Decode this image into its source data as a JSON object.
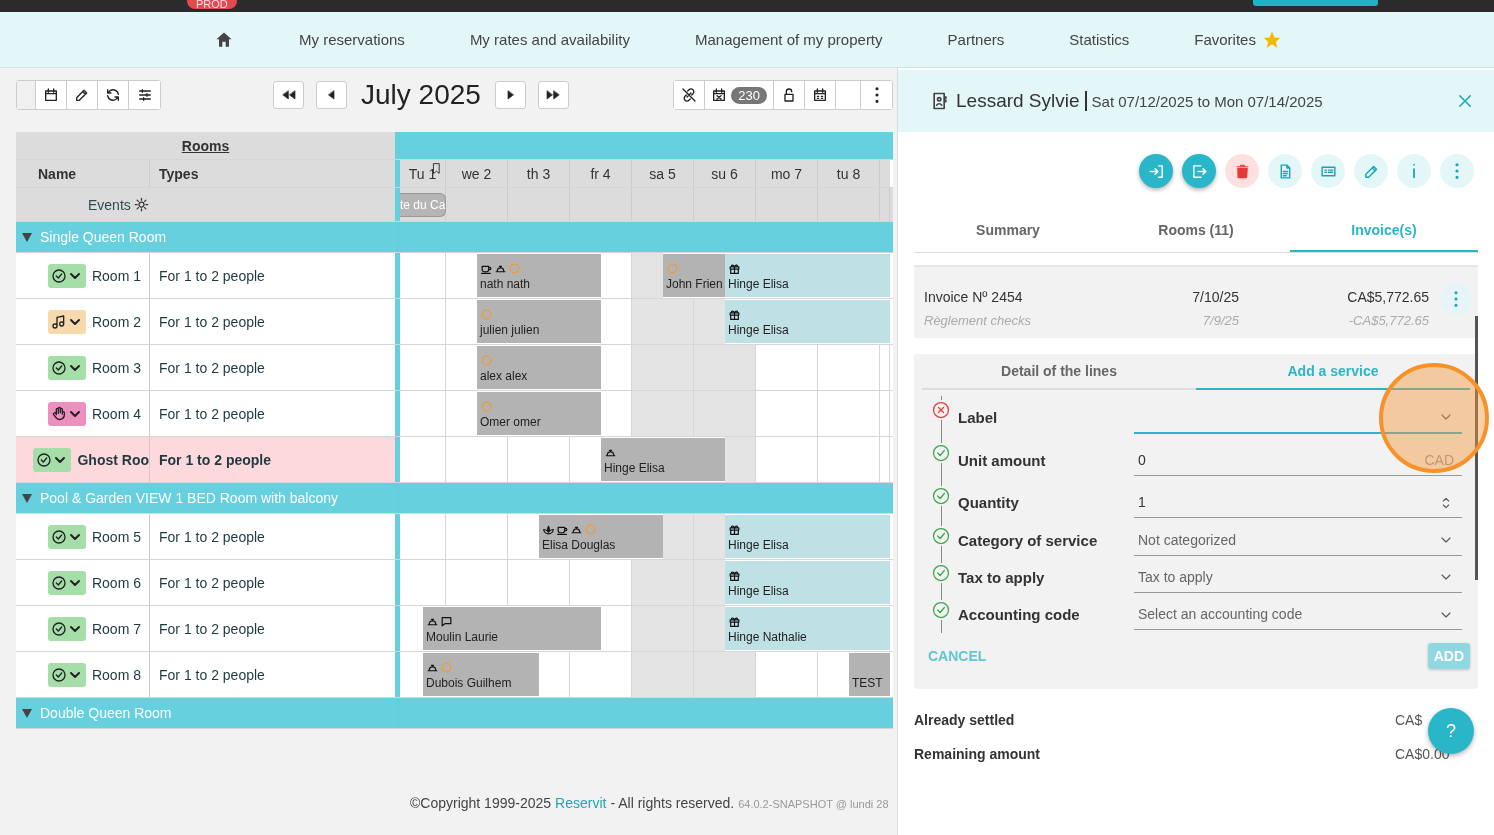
{
  "top_bar": {
    "env_badge": "PROD"
  },
  "nav": {
    "items": [
      {
        "label": "My reservations",
        "starred": false
      },
      {
        "label": "My rates and availability",
        "starred": false
      },
      {
        "label": "Management of my property",
        "starred": false
      },
      {
        "label": "Partners",
        "starred": false
      },
      {
        "label": "Statistics",
        "starred": false
      },
      {
        "label": "Favorites",
        "starred": true
      }
    ]
  },
  "planning": {
    "month": "July 2025",
    "closed_count": "230",
    "rooms_heading": "Rooms",
    "columns": [
      "Name",
      "Types"
    ],
    "events_label": "Events",
    "days": [
      {
        "label": "Tu 1",
        "weekend": false,
        "flagged": true,
        "event": "te du Ca"
      },
      {
        "label": "we 2",
        "weekend": false,
        "flagged": false
      },
      {
        "label": "th 3",
        "weekend": false,
        "flagged": false
      },
      {
        "label": "fr 4",
        "weekend": false,
        "flagged": false
      },
      {
        "label": "sa 5",
        "weekend": true,
        "flagged": false
      },
      {
        "label": "su 6",
        "weekend": true,
        "flagged": false
      },
      {
        "label": "mo 7",
        "weekend": false,
        "flagged": false
      },
      {
        "label": "tu 8",
        "weekend": false,
        "flagged": false
      }
    ],
    "groups": [
      {
        "name": "Single Queen Room",
        "expanded": true,
        "rooms": [
          {
            "name": "Room 1",
            "type": "For 1 to 2 people",
            "status": {
              "kind": "ok"
            },
            "highlighted": false,
            "nights": [
              {
                "booked": false
              },
              {
                "booked": true,
                "guest": "nath nath",
                "highlighted": false,
                "icons": [
                  {
                    "kind": "cup"
                  },
                  {
                    "kind": "bell"
                  },
                  {
                    "kind": "ring"
                  }
                ]
              },
              {
                "booked": true
              },
              {
                "booked": false
              },
              {
                "booked": true,
                "guest": "John Frien",
                "highlighted": false,
                "icons": [
                  {
                    "kind": "ring"
                  }
                ]
              },
              {
                "booked": true,
                "guest": "Hinge Elisa",
                "highlighted": true,
                "icons": [
                  {
                    "kind": "gift"
                  }
                ]
              },
              {
                "booked": true
              },
              {
                "booked": true
              },
              {
                "booked": true
              }
            ]
          },
          {
            "name": "Room 2",
            "type": "For 1 to 2 people",
            "status": {
              "kind": "music"
            },
            "highlighted": false,
            "nights": [
              {
                "booked": false
              },
              {
                "booked": true,
                "guest": "julien julien",
                "highlighted": false,
                "icons": [
                  {
                    "kind": "ring"
                  }
                ]
              },
              {
                "booked": true
              },
              {
                "booked": false
              },
              {
                "booked": false
              },
              {
                "booked": true,
                "guest": "Hinge Elisa",
                "highlighted": true,
                "icons": [
                  {
                    "kind": "gift"
                  }
                ]
              },
              {
                "booked": true
              },
              {
                "booked": true
              },
              {
                "booked": true
              }
            ]
          },
          {
            "name": "Room 3",
            "type": "For 1 to 2 people",
            "status": {
              "kind": "ok"
            },
            "highlighted": false,
            "nights": [
              {
                "booked": false
              },
              {
                "booked": true,
                "guest": "alex alex",
                "highlighted": false,
                "icons": [
                  {
                    "kind": "ring"
                  }
                ]
              },
              {
                "booked": true
              },
              {
                "booked": false
              },
              {
                "booked": false
              },
              {
                "booked": false
              },
              {
                "booked": false
              },
              {
                "booked": false
              },
              {
                "booked": false
              }
            ]
          },
          {
            "name": "Room 4",
            "type": "For 1 to 2 people",
            "status": {
              "kind": "hand"
            },
            "highlighted": false,
            "nights": [
              {
                "booked": false
              },
              {
                "booked": true,
                "guest": "Omer omer",
                "highlighted": false,
                "icons": [
                  {
                    "kind": "ring"
                  }
                ]
              },
              {
                "booked": true
              },
              {
                "booked": false
              },
              {
                "booked": false
              },
              {
                "booked": false
              },
              {
                "booked": false
              },
              {
                "booked": false
              },
              {
                "booked": false
              }
            ]
          },
          {
            "name": "Ghost Roo",
            "type": "For 1 to 2 people",
            "status": {
              "kind": "ok"
            },
            "highlighted": true,
            "nights": [
              {
                "booked": false
              },
              {
                "booked": false
              },
              {
                "booked": false
              },
              {
                "booked": true,
                "guest": "Hinge Elisa",
                "highlighted": false,
                "icons": [
                  {
                    "kind": "bell"
                  }
                ]
              },
              {
                "booked": true
              },
              {
                "booked": false
              },
              {
                "booked": false
              },
              {
                "booked": false
              },
              {
                "booked": false
              }
            ]
          }
        ]
      },
      {
        "name": "Pool & Garden VIEW 1 BED Room with balcony",
        "expanded": true,
        "rooms": [
          {
            "name": "Room 5",
            "type": "For 1 to 2 people",
            "status": {
              "kind": "ok"
            },
            "highlighted": false,
            "nights": [
              {
                "booked": false
              },
              {
                "booked": false
              },
              {
                "booked": true,
                "guest": "Elisa Douglas",
                "highlighted": false,
                "icons": [
                  {
                    "kind": "lotus"
                  },
                  {
                    "kind": "cup"
                  },
                  {
                    "kind": "bell"
                  },
                  {
                    "kind": "ring"
                  }
                ]
              },
              {
                "booked": true
              },
              {
                "booked": false
              },
              {
                "booked": true,
                "guest": "Hinge Elisa",
                "highlighted": true,
                "icons": [
                  {
                    "kind": "gift"
                  }
                ]
              },
              {
                "booked": true
              },
              {
                "booked": true
              },
              {
                "booked": true
              }
            ]
          },
          {
            "name": "Room 6",
            "type": "For 1 to 2 people",
            "status": {
              "kind": "ok"
            },
            "highlighted": false,
            "nights": [
              {
                "booked": false
              },
              {
                "booked": false
              },
              {
                "booked": false
              },
              {
                "booked": false
              },
              {
                "booked": false
              },
              {
                "booked": true,
                "guest": "Hinge Elisa",
                "highlighted": true,
                "icons": [
                  {
                    "kind": "gift"
                  }
                ]
              },
              {
                "booked": true
              },
              {
                "booked": true
              },
              {
                "booked": true
              }
            ]
          },
          {
            "name": "Room 7",
            "type": "For 1 to 2 people",
            "status": {
              "kind": "ok"
            },
            "highlighted": false,
            "nights": [
              {
                "booked": true,
                "guest": "Moulin Laurie",
                "highlighted": false,
                "icons": [
                  {
                    "kind": "bell"
                  },
                  {
                    "kind": "chat"
                  }
                ]
              },
              {
                "booked": true
              },
              {
                "booked": true
              },
              {
                "booked": false
              },
              {
                "booked": false
              },
              {
                "booked": true,
                "guest": "Hinge Nathalie",
                "highlighted": true,
                "icons": [
                  {
                    "kind": "gift"
                  }
                ]
              },
              {
                "booked": true
              },
              {
                "booked": true
              },
              {
                "booked": true
              }
            ]
          },
          {
            "name": "Room 8",
            "type": "For 1 to 2 people",
            "status": {
              "kind": "ok"
            },
            "highlighted": false,
            "nights": [
              {
                "booked": true,
                "guest": "Dubois Guilhem",
                "highlighted": false,
                "icons": [
                  {
                    "kind": "bell"
                  },
                  {
                    "kind": "ring"
                  }
                ]
              },
              {
                "booked": true
              },
              {
                "booked": false
              },
              {
                "booked": false
              },
              {
                "booked": false
              },
              {
                "booked": false
              },
              {
                "booked": false
              },
              {
                "booked": true,
                "guest": "TEST",
                "highlighted": false
              },
              {
                "booked": true
              }
            ]
          }
        ]
      },
      {
        "name": "Double Queen Room",
        "expanded": true
      }
    ]
  },
  "footer": {
    "copyright": "©Copyright 1999-2025",
    "link": "Reservit",
    "rights": "- All rights reserved.",
    "version": "64.0.2-SNAPSHOT @ lundi 28"
  },
  "booking_panel": {
    "guest": "Lessard Sylvie",
    "dates": "Sat 07/12/2025 to Mon 07/14/2025",
    "actions": [
      {
        "kind": "check-in"
      },
      {
        "kind": "check-out"
      },
      {
        "kind": "delete"
      },
      {
        "kind": "document"
      },
      {
        "kind": "payment"
      },
      {
        "kind": "edit"
      },
      {
        "kind": "info"
      },
      {
        "kind": "more"
      }
    ],
    "tabs": [
      {
        "label": "Summary",
        "selected": false
      },
      {
        "label": "Rooms (11)",
        "selected": false
      },
      {
        "label": "Invoice(s)",
        "selected": true
      }
    ],
    "invoice": {
      "number": "Invoice Nº 2454",
      "date": "7/10/25",
      "amount": "CA$5,772.65",
      "payment_label": "Règlement checks",
      "payment_date": "7/9/25",
      "payment_amount": "-CA$5,772.65"
    },
    "service_form": {
      "tabs": [
        {
          "label": "Detail of the lines",
          "selected": false
        },
        {
          "label": "Add a service",
          "selected": true
        }
      ],
      "fields": [
        {
          "label": "Label",
          "valid": false,
          "kind": "select",
          "focused": true
        },
        {
          "label": "Unit amount",
          "valid": true,
          "kind": "amount",
          "value": "0",
          "suffix": "CAD",
          "focused": false
        },
        {
          "label": "Quantity",
          "valid": true,
          "kind": "number",
          "value": "1",
          "focused": false
        },
        {
          "label": "Category of service",
          "valid": true,
          "kind": "select",
          "value": "Not categorized",
          "focused": false
        },
        {
          "label": "Tax to apply",
          "valid": true,
          "kind": "select",
          "value": "Tax to apply",
          "focused": false
        },
        {
          "label": "Accounting code",
          "valid": true,
          "kind": "select",
          "placeholder": "Select an accounting code",
          "focused": false
        }
      ],
      "cancel": "CANCEL",
      "add": "ADD"
    },
    "totals": [
      {
        "label": "Already settled",
        "amount": "CA$"
      },
      {
        "label": "Remaining amount",
        "amount": "CA$0.00"
      }
    ],
    "help": "?"
  }
}
